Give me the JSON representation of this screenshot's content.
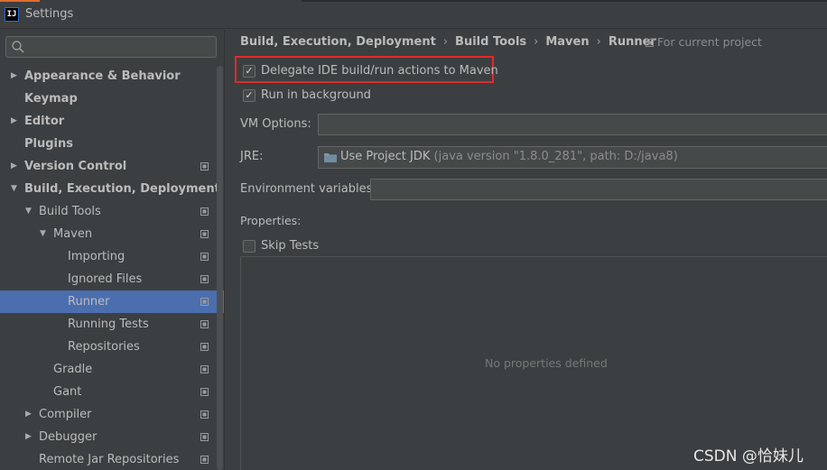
{
  "window": {
    "title": "Settings",
    "app_icon": "IJ"
  },
  "sidebar": {
    "search": {
      "placeholder": "",
      "value": ""
    },
    "items": [
      {
        "label": "Appearance & Behavior",
        "bold": true,
        "indent": 0,
        "arrow": "right",
        "project_icon": false,
        "selected": false
      },
      {
        "label": "Keymap",
        "bold": true,
        "indent": 0,
        "arrow": "none",
        "project_icon": false,
        "selected": false
      },
      {
        "label": "Editor",
        "bold": true,
        "indent": 0,
        "arrow": "right",
        "project_icon": false,
        "selected": false
      },
      {
        "label": "Plugins",
        "bold": true,
        "indent": 0,
        "arrow": "none",
        "project_icon": false,
        "selected": false
      },
      {
        "label": "Version Control",
        "bold": true,
        "indent": 0,
        "arrow": "right",
        "project_icon": true,
        "selected": false
      },
      {
        "label": "Build, Execution, Deployment",
        "bold": true,
        "indent": 0,
        "arrow": "down",
        "project_icon": false,
        "selected": false
      },
      {
        "label": "Build Tools",
        "bold": false,
        "indent": 1,
        "arrow": "down",
        "project_icon": true,
        "selected": false
      },
      {
        "label": "Maven",
        "bold": false,
        "indent": 2,
        "arrow": "down",
        "project_icon": true,
        "selected": false
      },
      {
        "label": "Importing",
        "bold": false,
        "indent": 3,
        "arrow": "none",
        "project_icon": true,
        "selected": false
      },
      {
        "label": "Ignored Files",
        "bold": false,
        "indent": 3,
        "arrow": "none",
        "project_icon": true,
        "selected": false
      },
      {
        "label": "Runner",
        "bold": false,
        "indent": 3,
        "arrow": "none",
        "project_icon": true,
        "selected": true
      },
      {
        "label": "Running Tests",
        "bold": false,
        "indent": 3,
        "arrow": "none",
        "project_icon": true,
        "selected": false
      },
      {
        "label": "Repositories",
        "bold": false,
        "indent": 3,
        "arrow": "none",
        "project_icon": true,
        "selected": false
      },
      {
        "label": "Gradle",
        "bold": false,
        "indent": 2,
        "arrow": "none",
        "project_icon": true,
        "selected": false
      },
      {
        "label": "Gant",
        "bold": false,
        "indent": 2,
        "arrow": "none",
        "project_icon": true,
        "selected": false
      },
      {
        "label": "Compiler",
        "bold": false,
        "indent": 1,
        "arrow": "right",
        "project_icon": true,
        "selected": false
      },
      {
        "label": "Debugger",
        "bold": false,
        "indent": 1,
        "arrow": "right",
        "project_icon": true,
        "selected": false
      },
      {
        "label": "Remote Jar Repositories",
        "bold": false,
        "indent": 1,
        "arrow": "none",
        "project_icon": true,
        "selected": false
      }
    ]
  },
  "breadcrumb": [
    "Build, Execution, Deployment",
    "Build Tools",
    "Maven",
    "Runner"
  ],
  "breadcrumb_separator": "›",
  "for_project": "For current project",
  "options": {
    "delegate": {
      "label": "Delegate IDE build/run actions to Maven",
      "checked": true
    },
    "background": {
      "label": "Run in background",
      "checked": true
    }
  },
  "fields": {
    "vm_options": {
      "label": "VM Options:",
      "value": ""
    },
    "jre": {
      "label": "JRE:",
      "value": "Use Project JDK",
      "hint": "(java version \"1.8.0_281\", path: D:/java8)"
    },
    "env_vars": {
      "label": "Environment variables:",
      "value": ""
    }
  },
  "properties": {
    "label": "Properties:",
    "skip_tests": {
      "label": "Skip Tests",
      "checked": false
    },
    "empty_text": "No properties defined"
  },
  "watermark": "CSDN @恰妹儿",
  "colors": {
    "selection": "#4b6eaf",
    "highlight_border": "#e12a2a",
    "background": "#3c3f41"
  }
}
